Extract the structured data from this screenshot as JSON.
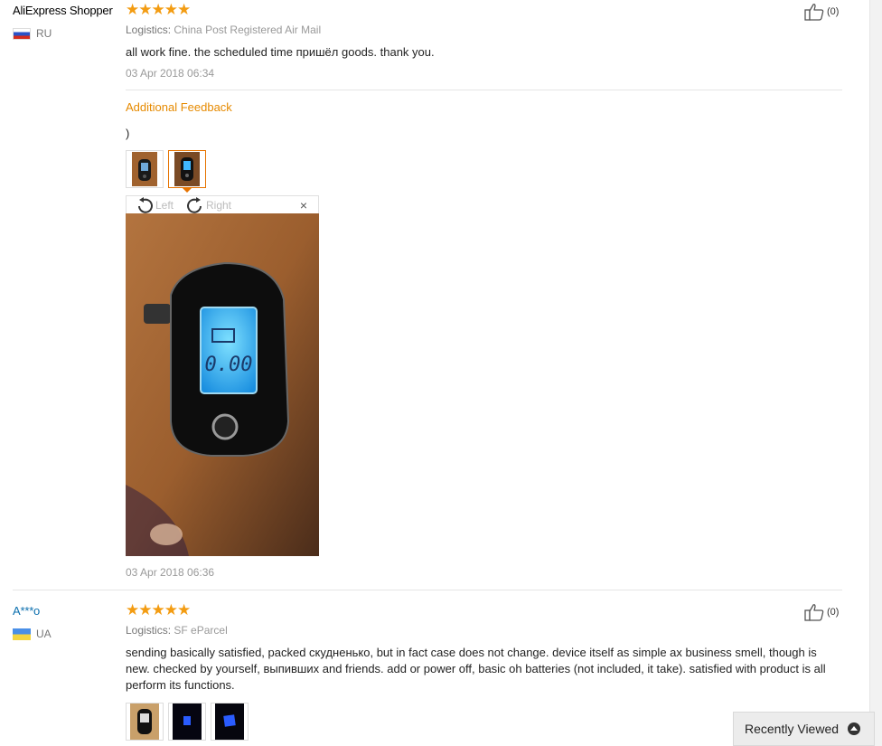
{
  "reviews": [
    {
      "user": "AliExpress Shopper",
      "country": "RU",
      "rating_text": "★★★★★",
      "rating": 5,
      "logistics_label": "Logistics:",
      "logistics_value": "China Post Registered Air Mail",
      "text": "all work fine. the scheduled time пришёл goods. thank you.",
      "date": "03 Apr 2018 06:34",
      "like_count": "(0)",
      "additional": {
        "title": "Additional Feedback",
        "text": ")",
        "date": "03 Apr 2018 06:36",
        "viewer": {
          "rotate_left": "Left",
          "rotate_right": "Right",
          "close": "×",
          "display": "0.00"
        }
      }
    },
    {
      "user": "A***o",
      "country": "UA",
      "rating_text": "★★★★★",
      "rating": 5,
      "logistics_label": "Logistics:",
      "logistics_value": "SF eParcel",
      "text": "sending basically satisfied, packed скудненько, but in fact case does not change. device itself as simple ax business smell, though is new. checked by yourself, выпивших and friends. add or power off, basic oh batteries (not included, it take). satisfied with product is all perform its functions.",
      "like_count": "(0)"
    }
  ],
  "recently_viewed": "Recently Viewed"
}
